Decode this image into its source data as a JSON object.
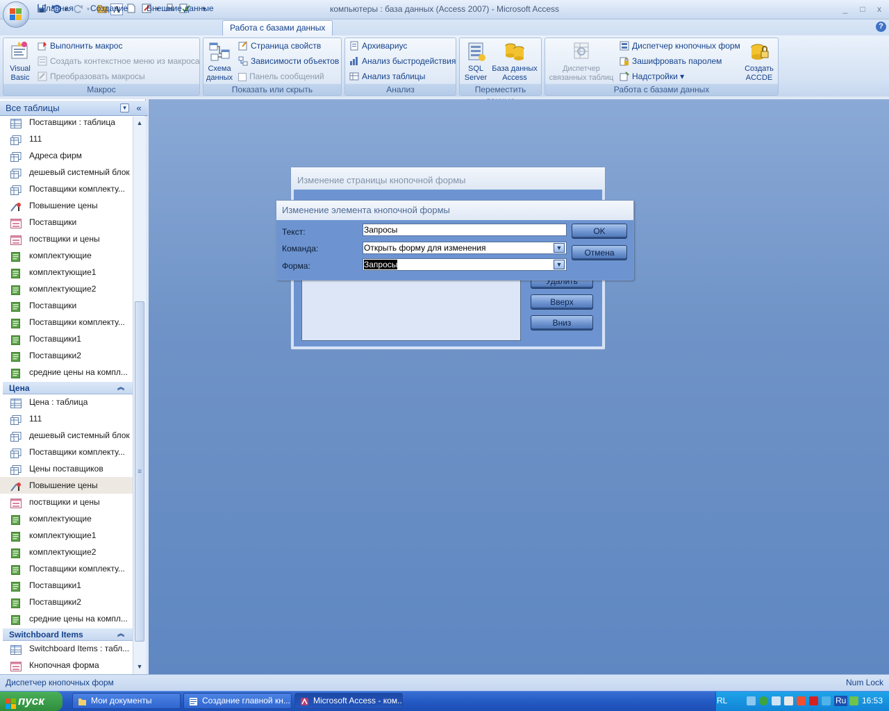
{
  "window": {
    "title": "компьютеры : база данных (Access 2007)  -  Microsoft Access",
    "controls": [
      "_",
      "□",
      "x"
    ]
  },
  "qat": {
    "customize": "▾"
  },
  "ribbon": {
    "tabs": [
      {
        "label": "Главная",
        "active": false
      },
      {
        "label": "Создание",
        "active": false
      },
      {
        "label": "Внешние данные",
        "active": false
      },
      {
        "label": "Работа с базами данных",
        "active": true
      }
    ],
    "help": "?",
    "groups": {
      "macro": {
        "label": "Макрос",
        "big": {
          "line1": "Visual",
          "line2": "Basic"
        },
        "items": [
          "Выполнить макрос",
          "Создать контекстное меню из макроса",
          "Преобразовать макросы"
        ]
      },
      "show": {
        "label": "Показать или скрыть",
        "big": {
          "line1": "Схема",
          "line2": "данных"
        },
        "items": [
          "Страница свойств",
          "Зависимости объектов",
          "Панель сообщений"
        ]
      },
      "analysis": {
        "label": "Анализ",
        "items": [
          "Архивариус",
          "Анализ быстродействия",
          "Анализ таблицы"
        ]
      },
      "move": {
        "label": "Переместить данные",
        "sql": {
          "line1": "SQL",
          "line2": "Server"
        },
        "access": {
          "line1": "База данных",
          "line2": "Access"
        }
      },
      "tools": {
        "label": "Работа с базами данных",
        "linked": {
          "line1": "Диспетчер",
          "line2": "связанных таблиц"
        },
        "items": [
          "Диспетчер кнопочных форм",
          "Зашифровать паролем",
          "Надстройки ▾"
        ],
        "accde": {
          "line1": "Создать",
          "line2": "ACCDE"
        }
      }
    }
  },
  "nav": {
    "header": "Все таблицы",
    "header_dropdown": "▾",
    "collapse": "«",
    "scroll_up": "▲",
    "scroll_down": "▼",
    "scroll_grip": "≡",
    "group1": {
      "items": [
        {
          "label": "Поставщики : таблица",
          "icon": "table"
        },
        {
          "label": "111",
          "icon": "query"
        },
        {
          "label": "Адреса фирм",
          "icon": "query"
        },
        {
          "label": "дешевый системный блок",
          "icon": "query"
        },
        {
          "label": "Поставщики комплекту...",
          "icon": "query"
        },
        {
          "label": "Повышение цены",
          "icon": "action"
        },
        {
          "label": "Поставщики",
          "icon": "form"
        },
        {
          "label": "поствщики и цены",
          "icon": "form"
        },
        {
          "label": "комплектующие",
          "icon": "report"
        },
        {
          "label": "комплектующие1",
          "icon": "report"
        },
        {
          "label": "комплектующие2",
          "icon": "report"
        },
        {
          "label": "Поставщики",
          "icon": "report"
        },
        {
          "label": "Поставщики комплекту...",
          "icon": "report"
        },
        {
          "label": "Поставщики1",
          "icon": "report"
        },
        {
          "label": "Поставщики2",
          "icon": "report"
        },
        {
          "label": "средние цены на компл...",
          "icon": "report"
        }
      ]
    },
    "group2": {
      "title": "Цена",
      "chevron": "︽",
      "items": [
        {
          "label": "Цена : таблица",
          "icon": "table"
        },
        {
          "label": "111",
          "icon": "query"
        },
        {
          "label": "дешевый системный блок",
          "icon": "query"
        },
        {
          "label": "Поставщики комплекту...",
          "icon": "query"
        },
        {
          "label": "Цены поставщиков",
          "icon": "query"
        },
        {
          "label": "Повышение цены",
          "icon": "action"
        },
        {
          "label": "поствщики и цены",
          "icon": "form"
        },
        {
          "label": "комплектующие",
          "icon": "report"
        },
        {
          "label": "комплектующие1",
          "icon": "report"
        },
        {
          "label": "комплектующие2",
          "icon": "report"
        },
        {
          "label": "Поставщики комплекту...",
          "icon": "report"
        },
        {
          "label": "Поставщики1",
          "icon": "report"
        },
        {
          "label": "Поставщики2",
          "icon": "report"
        },
        {
          "label": "средние цены на компл...",
          "icon": "report"
        }
      ]
    },
    "group3": {
      "title": "Switchboard Items",
      "chevron": "︽",
      "items": [
        {
          "label": "Switchboard Items : табл...",
          "icon": "table"
        },
        {
          "label": "Кнопочная форма",
          "icon": "form"
        }
      ]
    }
  },
  "dialog_page": {
    "title": "Изменение страницы кнопочной формы",
    "buttons": [
      "Удалить",
      "Вверх",
      "Вниз"
    ]
  },
  "dialog_item": {
    "title": "Изменение элемента кнопочной формы",
    "text_label": "Текст:",
    "text_value": "Запросы",
    "command_label": "Команда:",
    "command_value": "Открыть форму для изменения",
    "form_label": "Форма:",
    "form_value": "Запросы",
    "ok": "OK",
    "cancel": "Отмена"
  },
  "status": {
    "left": "Диспетчер кнопочных форм",
    "right": "Num Lock"
  },
  "taskbar": {
    "start": "пуск",
    "tasks": [
      {
        "label": "Мои документы",
        "active": false
      },
      {
        "label": "Создание главной кн...",
        "active": false
      },
      {
        "label": "Microsoft Access - ком...",
        "active": true
      }
    ],
    "lang": "RL",
    "layout": "Ru",
    "clock": "16:53"
  },
  "colors": {
    "ribbon_text": "#15428b",
    "workspace": "#6f93c7",
    "taskbar": "#245ac4",
    "start": "#2e8d3c"
  }
}
